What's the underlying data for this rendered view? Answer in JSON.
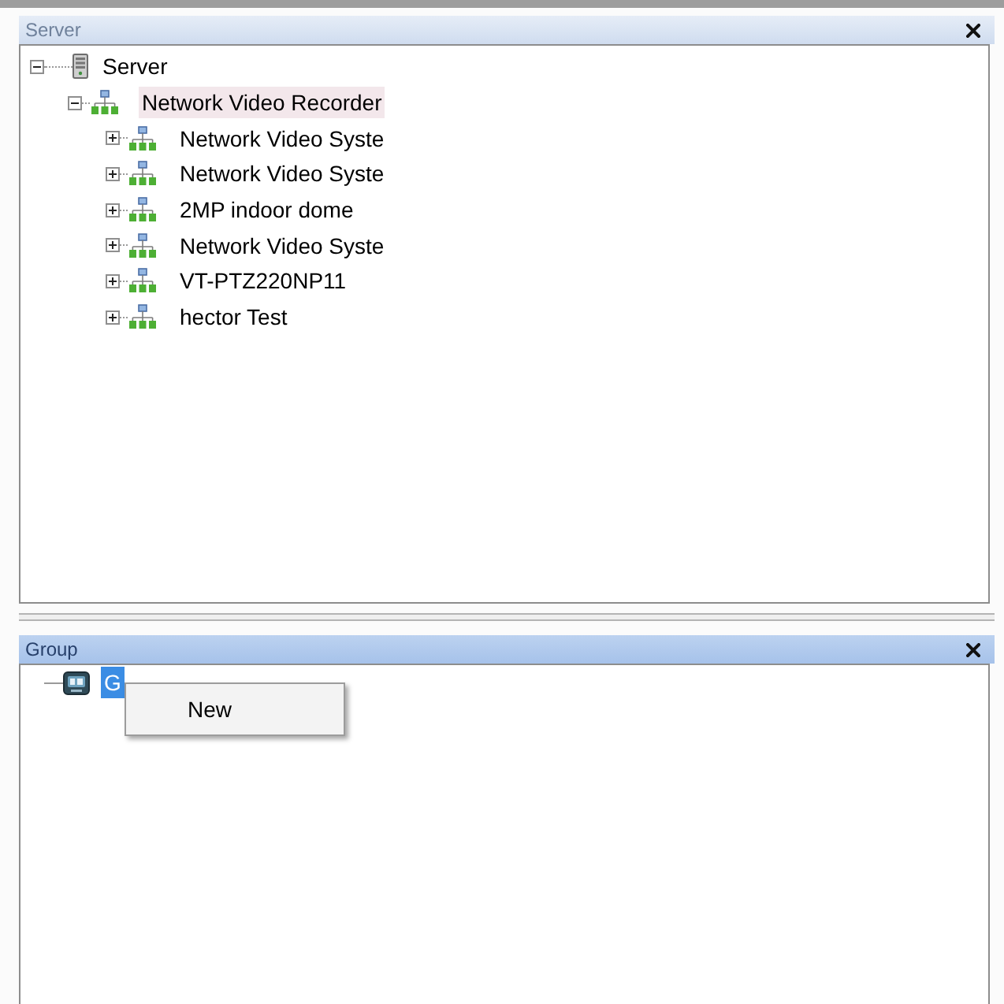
{
  "server_panel": {
    "title": "Server",
    "active": false,
    "tree": [
      {
        "label": "Server",
        "kind": "server",
        "expanded": true,
        "selected": false,
        "hovered": false,
        "children": [
          {
            "label": "Network Video Recorder",
            "kind": "network",
            "expanded": true,
            "selected": false,
            "hovered": true,
            "children": [
              {
                "label": "Network Video Syste",
                "kind": "network",
                "expanded": false,
                "selected": false,
                "hovered": false
              },
              {
                "label": "Network Video Syste",
                "kind": "network",
                "expanded": false,
                "selected": false,
                "hovered": false
              },
              {
                "label": "2MP indoor dome",
                "kind": "network",
                "expanded": false,
                "selected": false,
                "hovered": false
              },
              {
                "label": "Network Video Syste",
                "kind": "network",
                "expanded": false,
                "selected": false,
                "hovered": false
              },
              {
                "label": "VT-PTZ220NP11",
                "kind": "network",
                "expanded": false,
                "selected": false,
                "hovered": false
              },
              {
                "label": "hector Test",
                "kind": "network",
                "expanded": false,
                "selected": false,
                "hovered": false
              }
            ]
          }
        ]
      }
    ]
  },
  "group_panel": {
    "title": "Group",
    "active": true,
    "tree": [
      {
        "label": "G",
        "kind": "group",
        "selected": true
      }
    ]
  },
  "context_menu": {
    "items": [
      {
        "label": "New"
      }
    ]
  }
}
